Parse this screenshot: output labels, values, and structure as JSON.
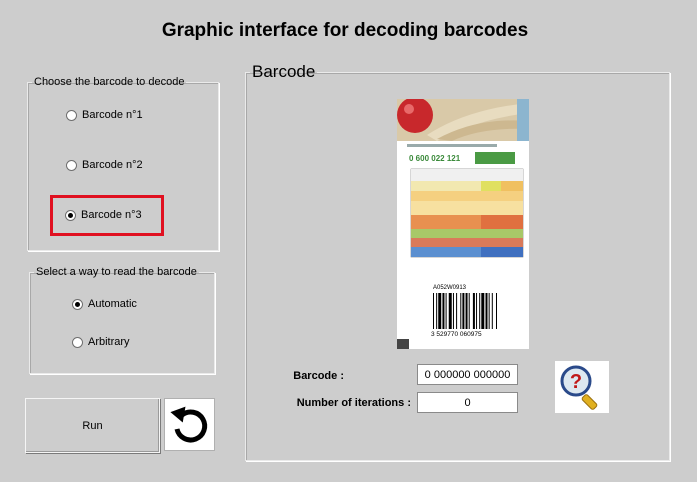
{
  "app": {
    "title": "Graphic interface for decoding barcodes"
  },
  "choose_group": {
    "legend": "Choose the barcode to decode",
    "options": [
      "Barcode n°1",
      "Barcode n°2",
      "Barcode n°3"
    ],
    "selected": "Barcode n°3"
  },
  "read_group": {
    "legend": "Select a way to read the barcode",
    "options": [
      "Automatic",
      "Arbitrary"
    ],
    "selected": "Automatic"
  },
  "buttons": {
    "run_label": "Run"
  },
  "barcode_panel": {
    "legend": "Barcode",
    "barcode_label": "Barcode :",
    "barcode_value": "0 000000 000000",
    "iterations_label": "Number of iterations :",
    "iterations_value": "0",
    "image": {
      "code_text": "0 600 022 121",
      "lot_text": "A052W0913",
      "bar_digits": "3 529770 060975"
    }
  },
  "icons": {
    "reset": "rotate-arrow-icon",
    "search": "magnifier-question-icon"
  },
  "colors": {
    "highlight": "#e01020",
    "background": "#cdcdcd"
  }
}
